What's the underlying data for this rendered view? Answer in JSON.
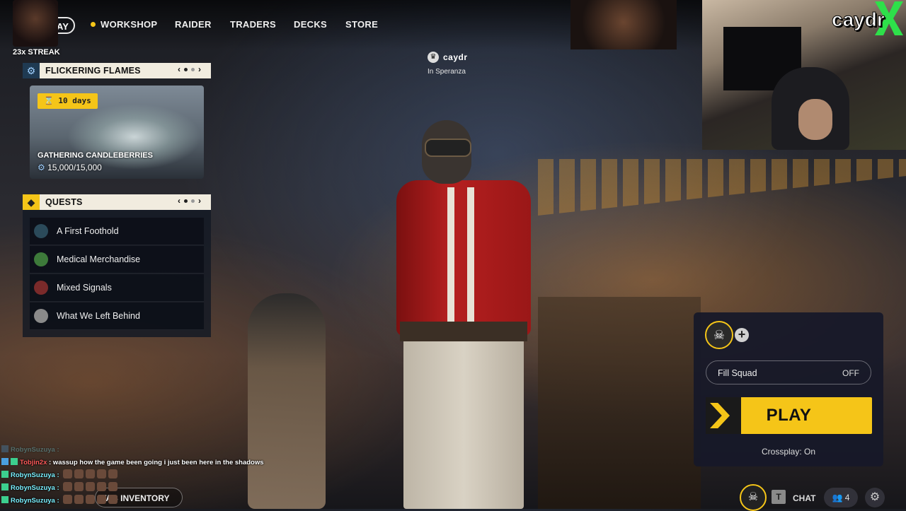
{
  "nav": {
    "play_label": "AY",
    "items": [
      "WORKSHOP",
      "RAIDER",
      "TRADERS",
      "DECKS",
      "STORE"
    ]
  },
  "overlay": {
    "streak": "23x STREAK",
    "brand": "caydr"
  },
  "player": {
    "name": "caydr",
    "location": "In Speranza"
  },
  "event_panel": {
    "title": "FLICKERING FLAMES",
    "badge": "10 days",
    "event_name": "GATHERING CANDLEBERRIES",
    "progress": "15,000/15,000",
    "icon": "gear-icon"
  },
  "quests_panel": {
    "title": "QUESTS",
    "icon": "diamond-icon",
    "items": [
      {
        "label": "A First Foothold",
        "color": "#2b4a5a"
      },
      {
        "label": "Medical Merchandise",
        "color": "#3d7a3a"
      },
      {
        "label": "Mixed Signals",
        "color": "#7a2a2a"
      },
      {
        "label": "What We Left Behind",
        "color": "#8a8a8a"
      }
    ]
  },
  "squad": {
    "fill_label": "Fill Squad",
    "fill_state": "OFF",
    "play_label": "PLAY",
    "crossplay": "Crossplay: On"
  },
  "bottom": {
    "key": "T",
    "chat_label": "CHAT",
    "friends_count": "4",
    "inventory_label": "TAB  INVENTORY"
  },
  "stream_chat": [
    {
      "user": "RobynSuzuya :",
      "msg": "",
      "emotes": 0,
      "faded": true
    },
    {
      "user": "Tobjin2x",
      "msg": ": wassup how the game been going i just been here in the shadows",
      "emotes": 0,
      "red": true
    },
    {
      "user": "RobynSuzuya :",
      "msg": "",
      "emotes": 5
    },
    {
      "user": "RobynSuzuya :",
      "msg": "",
      "emotes": 5
    },
    {
      "user": "RobynSuzuya :",
      "msg": "",
      "emotes": 5
    }
  ],
  "colors": {
    "accent": "#f5c518",
    "panel_header_bg": "#f1ecdf",
    "squad_bg": "#161828"
  }
}
